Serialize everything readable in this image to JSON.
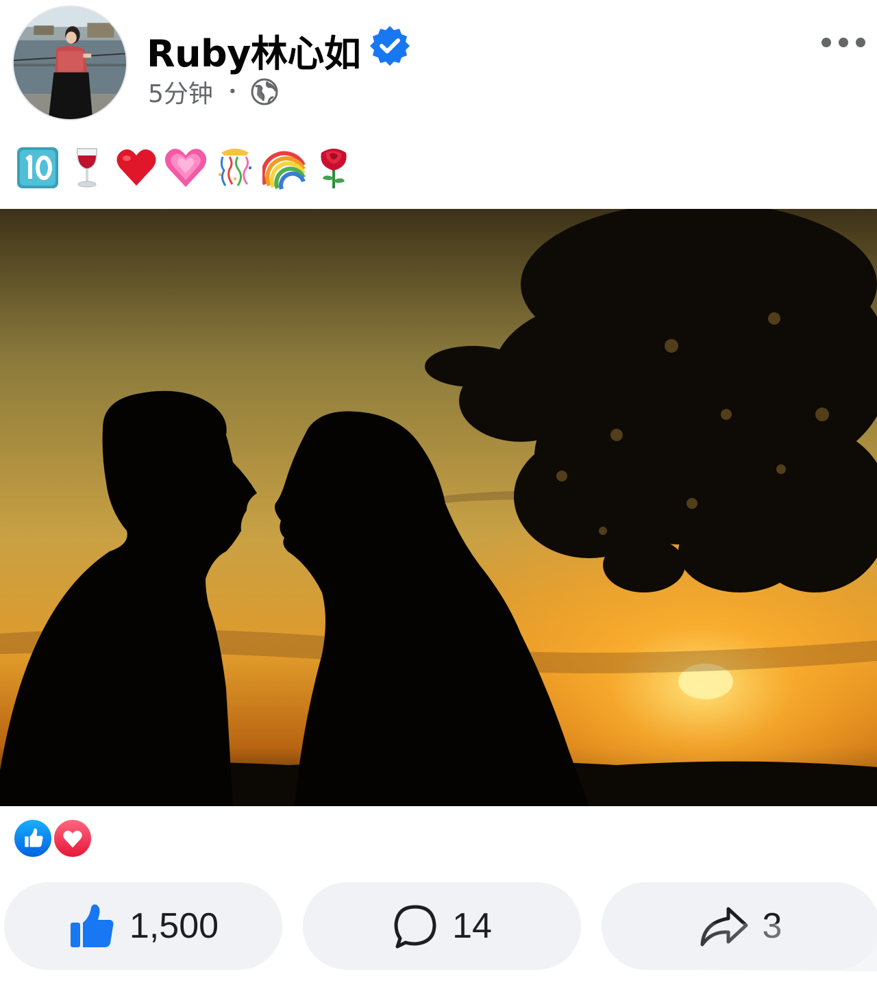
{
  "post": {
    "author": "Ruby林心如",
    "verified": true,
    "time": "5分钟",
    "separator": "•",
    "audience_icon": "globe-icon",
    "more_icon": "more-dots-icon",
    "caption_emojis": [
      "keycap-ten-icon",
      "wine-glass-icon",
      "red-heart-icon",
      "pink-heart-icon",
      "confetti-icon",
      "rainbow-icon",
      "rose-icon"
    ]
  },
  "reactions": {
    "icons": [
      "like-reaction-icon",
      "love-reaction-icon"
    ]
  },
  "actions": {
    "like_count": "1,500",
    "comment_count": "14",
    "share_count": "3"
  },
  "colors": {
    "accent": "#1877f2",
    "secondary_text": "#65676b",
    "pill_bg": "#f0f2f5",
    "love": "#f33e58"
  }
}
